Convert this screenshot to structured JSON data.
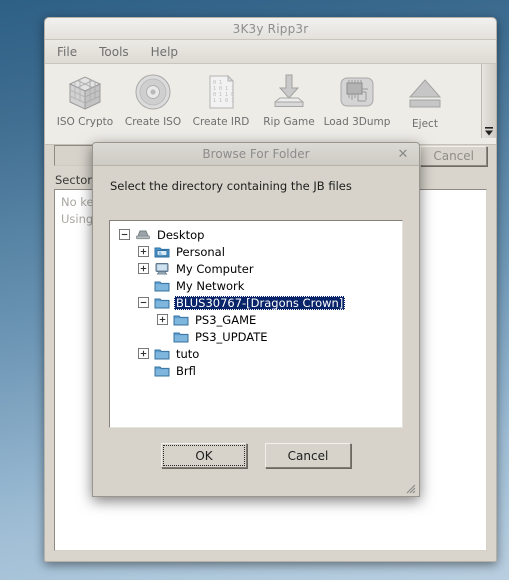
{
  "main_window": {
    "title": "3K3y Ripp3r",
    "menu": [
      {
        "label": "File"
      },
      {
        "label": "Tools"
      },
      {
        "label": "Help"
      }
    ],
    "toolbar": {
      "buttons": [
        {
          "label": "ISO Crypto",
          "icon": "cube-icon"
        },
        {
          "label": "Create ISO",
          "icon": "disc-icon"
        },
        {
          "label": "Create IRD",
          "icon": "binary-document-icon"
        },
        {
          "label": "Rip Game",
          "icon": "download-drive-icon"
        },
        {
          "label": "Load 3Dump",
          "icon": "chip-icon"
        },
        {
          "label": "Eject",
          "icon": "eject-icon"
        }
      ],
      "scrollbar_arrow": "▼"
    },
    "path_field": {
      "value": "",
      "placeholder": ""
    },
    "cancel_button": {
      "label": "Cancel",
      "enabled": false
    },
    "sectors_label": "Sectors:",
    "log_lines": [
      "No key data",
      "Using defau"
    ]
  },
  "dialog": {
    "title": "Browse For Folder",
    "close_icon": "✕",
    "prompt": "Select the directory containing the JB files",
    "tree": [
      {
        "label": "Desktop",
        "depth": 0,
        "expander": "minus",
        "icon": "desktop-icon",
        "selected": false
      },
      {
        "label": "Personal",
        "depth": 1,
        "expander": "plus",
        "icon": "picture-folder-icon",
        "selected": false
      },
      {
        "label": "My Computer",
        "depth": 1,
        "expander": "plus",
        "icon": "computer-icon",
        "selected": false
      },
      {
        "label": "My Network",
        "depth": 1,
        "expander": "none",
        "icon": "network-icon",
        "selected": false
      },
      {
        "label": "BLUS30767-[Dragons Crown]",
        "depth": 1,
        "expander": "minus",
        "icon": "folder-icon",
        "selected": true
      },
      {
        "label": "PS3_GAME",
        "depth": 2,
        "expander": "plus",
        "icon": "folder-icon",
        "selected": false
      },
      {
        "label": "PS3_UPDATE",
        "depth": 2,
        "expander": "none",
        "icon": "folder-icon",
        "selected": false
      },
      {
        "label": "tuto",
        "depth": 1,
        "expander": "plus",
        "icon": "folder-icon",
        "selected": false
      },
      {
        "label": "Brfl",
        "depth": 1,
        "expander": "none",
        "icon": "folder-icon",
        "selected": false
      }
    ],
    "ok_button": {
      "label": "OK",
      "focused": true
    },
    "cancel_button": {
      "label": "Cancel",
      "focused": false
    }
  },
  "colors": {
    "selection_blue": "#0a246a",
    "window_face": "#d9d5cd",
    "desktop_top": "#2e5f85",
    "desktop_bottom": "#b9cfe0"
  }
}
